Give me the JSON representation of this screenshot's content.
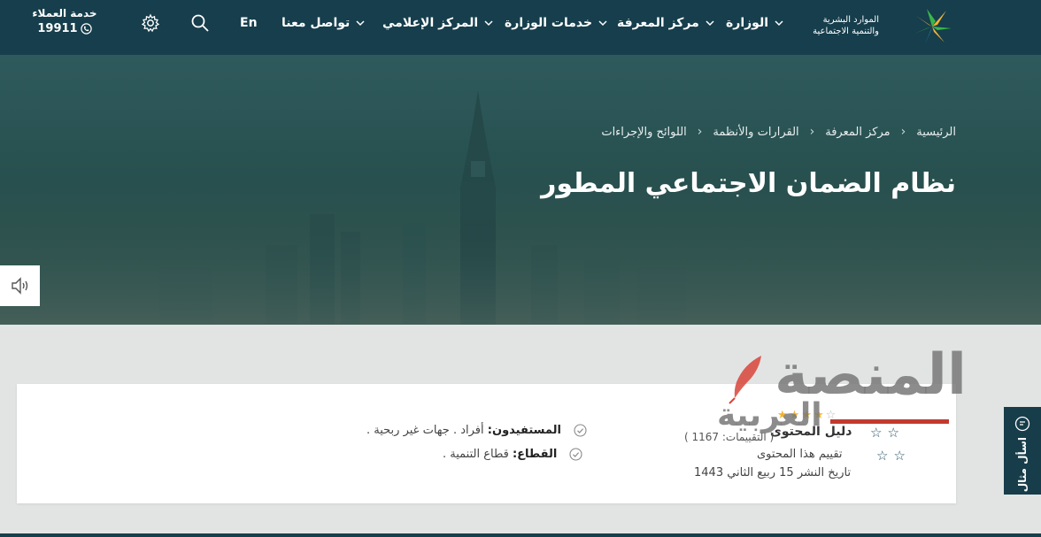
{
  "header": {
    "logo_line1": "الموارد البشرية",
    "logo_line2": "والتنمية الاجتماعية",
    "nav": [
      {
        "label": "الوزارة"
      },
      {
        "label": "مركز المعرفة"
      },
      {
        "label": "خدمات الوزارة"
      },
      {
        "label": "المركز الإعلامي"
      },
      {
        "label": "تواصل معنا"
      }
    ],
    "lang_label": "En",
    "customer_service_label": "خدمة العملاء",
    "customer_service_number": "19911"
  },
  "hero": {
    "breadcrumbs": [
      "الرئيسية",
      "مركز المعرفة",
      "القرارات والأنظمة",
      "اللوائح والإجراءات"
    ],
    "title": "نظام الضمان الاجتماعي المطور"
  },
  "content": {
    "beneficiaries_label": "المستفيدون:",
    "beneficiaries_value": "أفراد . جهات غير ربحية .",
    "sector_label": "القطاع:",
    "sector_value": "قطاع التنمية .",
    "guide_label": "دليل المحتوى",
    "rating_count_text": "( التقييمات: 1167 )",
    "rate_label": "تقييم هذا المحتوى",
    "publish_date": "تاريخ النشر 15 ربيع الثاني 1443"
  },
  "watermark": {
    "line1": "المنصة",
    "line2": "العربية"
  },
  "ask_button_label": "اسأل مثال",
  "colors": {
    "topbar": "#163e4c",
    "accent_gold": "#f2b233",
    "accent_green": "#3ab54a",
    "hero_teal": "#2a5454"
  }
}
